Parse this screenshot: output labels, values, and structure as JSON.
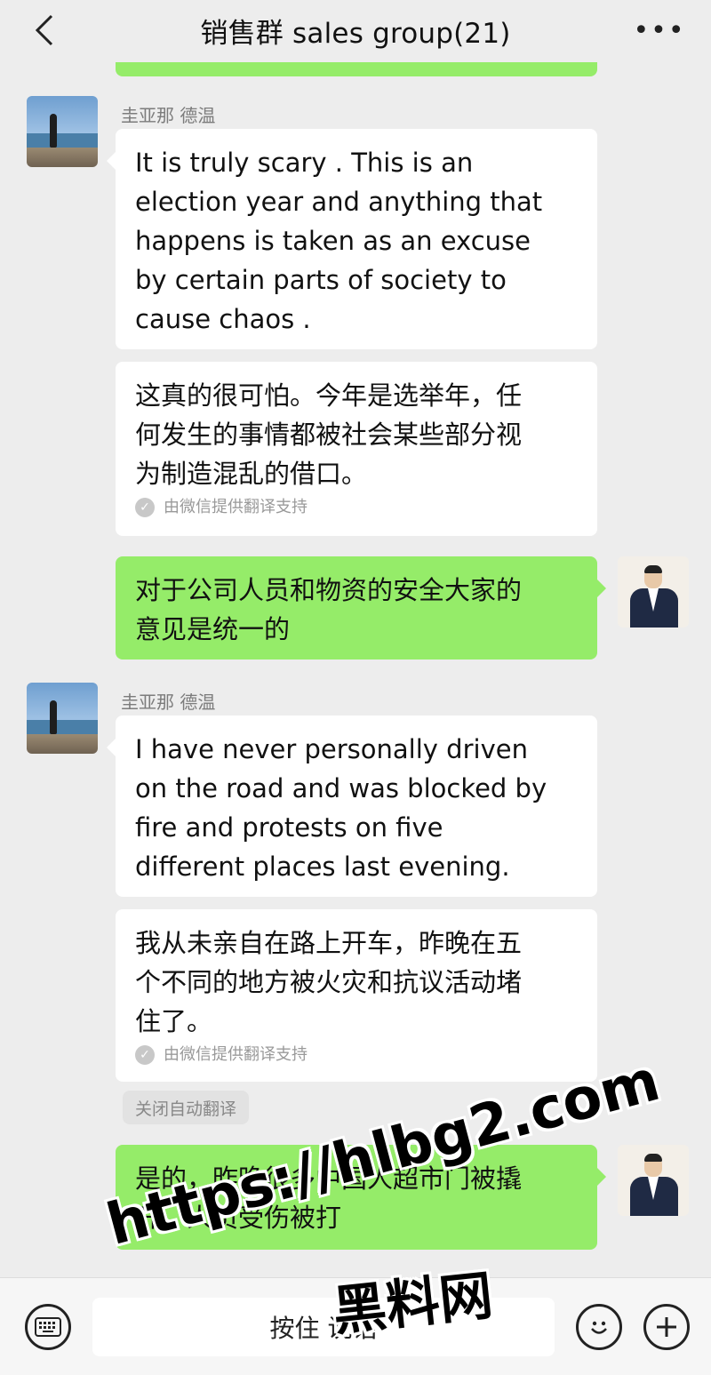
{
  "header": {
    "title": "销售群 sales group(21)",
    "back_icon": "chevron-left-icon",
    "more_label": "•••"
  },
  "messages": [
    {
      "sender": "圭亚那 德温",
      "avatar": "beach-avatar",
      "original": "It is truly scary . This is an\nelection year and anything that\nhappens is taken as an excuse\nby certain parts of society to\ncause chaos .",
      "translation": "这真的很可怕。今年是选举年，任\n何发生的事情都被社会某些部分视\n为制造混乱的借口。",
      "translation_note": "由微信提供翻译支持"
    },
    {
      "sender": "",
      "avatar": "man-avatar",
      "original": "对于公司人员和物资的安全大家的\n意见是统一的"
    },
    {
      "sender": "圭亚那 德温",
      "avatar": "beach-avatar",
      "original": "I have never personally driven\non the road and was blocked by\nfire and protests on five\ndifferent places last evening.",
      "translation": "我从未亲自在路上开车，昨晚在五\n个不同的地方被火灾和抗议活动堵\n住了。",
      "translation_note": "由微信提供翻译支持"
    },
    {
      "sender": "",
      "avatar": "man-avatar",
      "original": "是的，昨晚很多中国人超市门被撬\n开，人员受伤被打"
    }
  ],
  "chip_label": "关闭自动翻译",
  "bottom_bar": {
    "hold_to_talk": "按住 说话",
    "keyboard_icon": "keyboard-icon",
    "emoji_icon": "emoji-icon",
    "plus_icon": "plus-icon"
  },
  "watermark": {
    "line1": "https://hlbg2.com",
    "line2": "黑料网"
  },
  "colors": {
    "background": "#ededed",
    "bubble_green": "#95ec69",
    "bubble_white": "#ffffff"
  }
}
